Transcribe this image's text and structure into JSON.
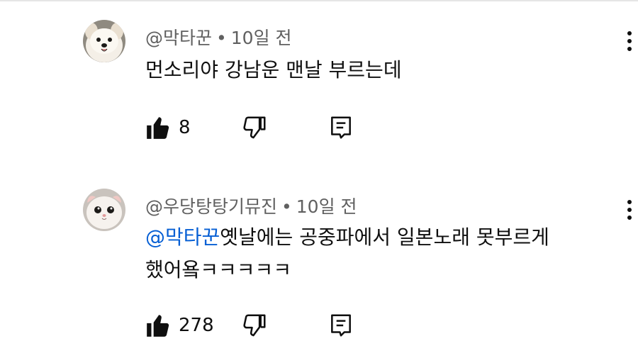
{
  "comments": [
    {
      "author": "@막타꾼",
      "time": "10일 전",
      "mention": "",
      "text": "먼소리야 강남운 맨날 부르는데",
      "text_line2": "",
      "likes": "8",
      "avatar_icon": "dog-avatar-icon"
    },
    {
      "author": "@우당탕탕기뮤진",
      "time": "10일 전",
      "mention": "@막타꾼",
      "text": "옛날에는 공중파에서 일본노래 못부르게",
      "text_line2": "했어욬ㅋㅋㅋㅋㅋ",
      "likes": "278",
      "avatar_icon": "cat-avatar-icon"
    }
  ],
  "separator": "•",
  "colors": {
    "mention": "#065fd4",
    "meta": "#606060",
    "text": "#0f0f0f"
  }
}
